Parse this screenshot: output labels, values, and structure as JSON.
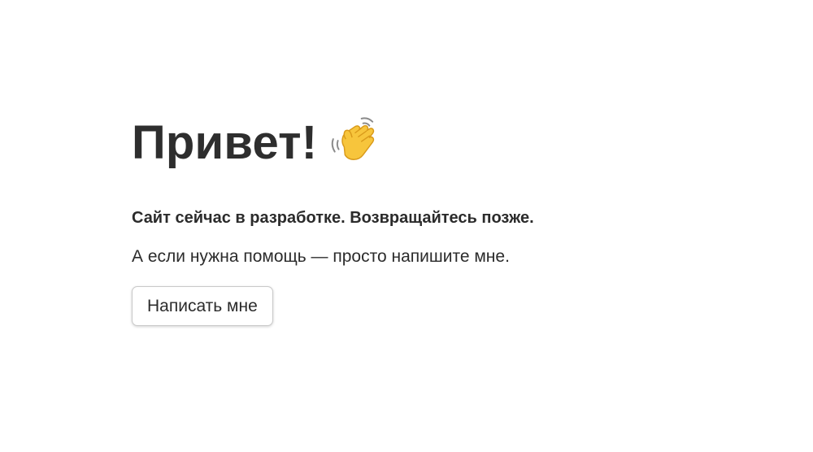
{
  "page": {
    "title": "Привет!",
    "title_icon": "waving-hand-icon",
    "lead": "Сайт сейчас в разработке. Возвращайтесь позже.",
    "subtext": "А если нужна помощь — просто напишите мне.",
    "button_label": "Написать мне"
  },
  "colors": {
    "text": "#2b2b2b",
    "background": "#ffffff",
    "button_border": "#c9c9c9",
    "emoji_yellow": "#f7c53c"
  }
}
